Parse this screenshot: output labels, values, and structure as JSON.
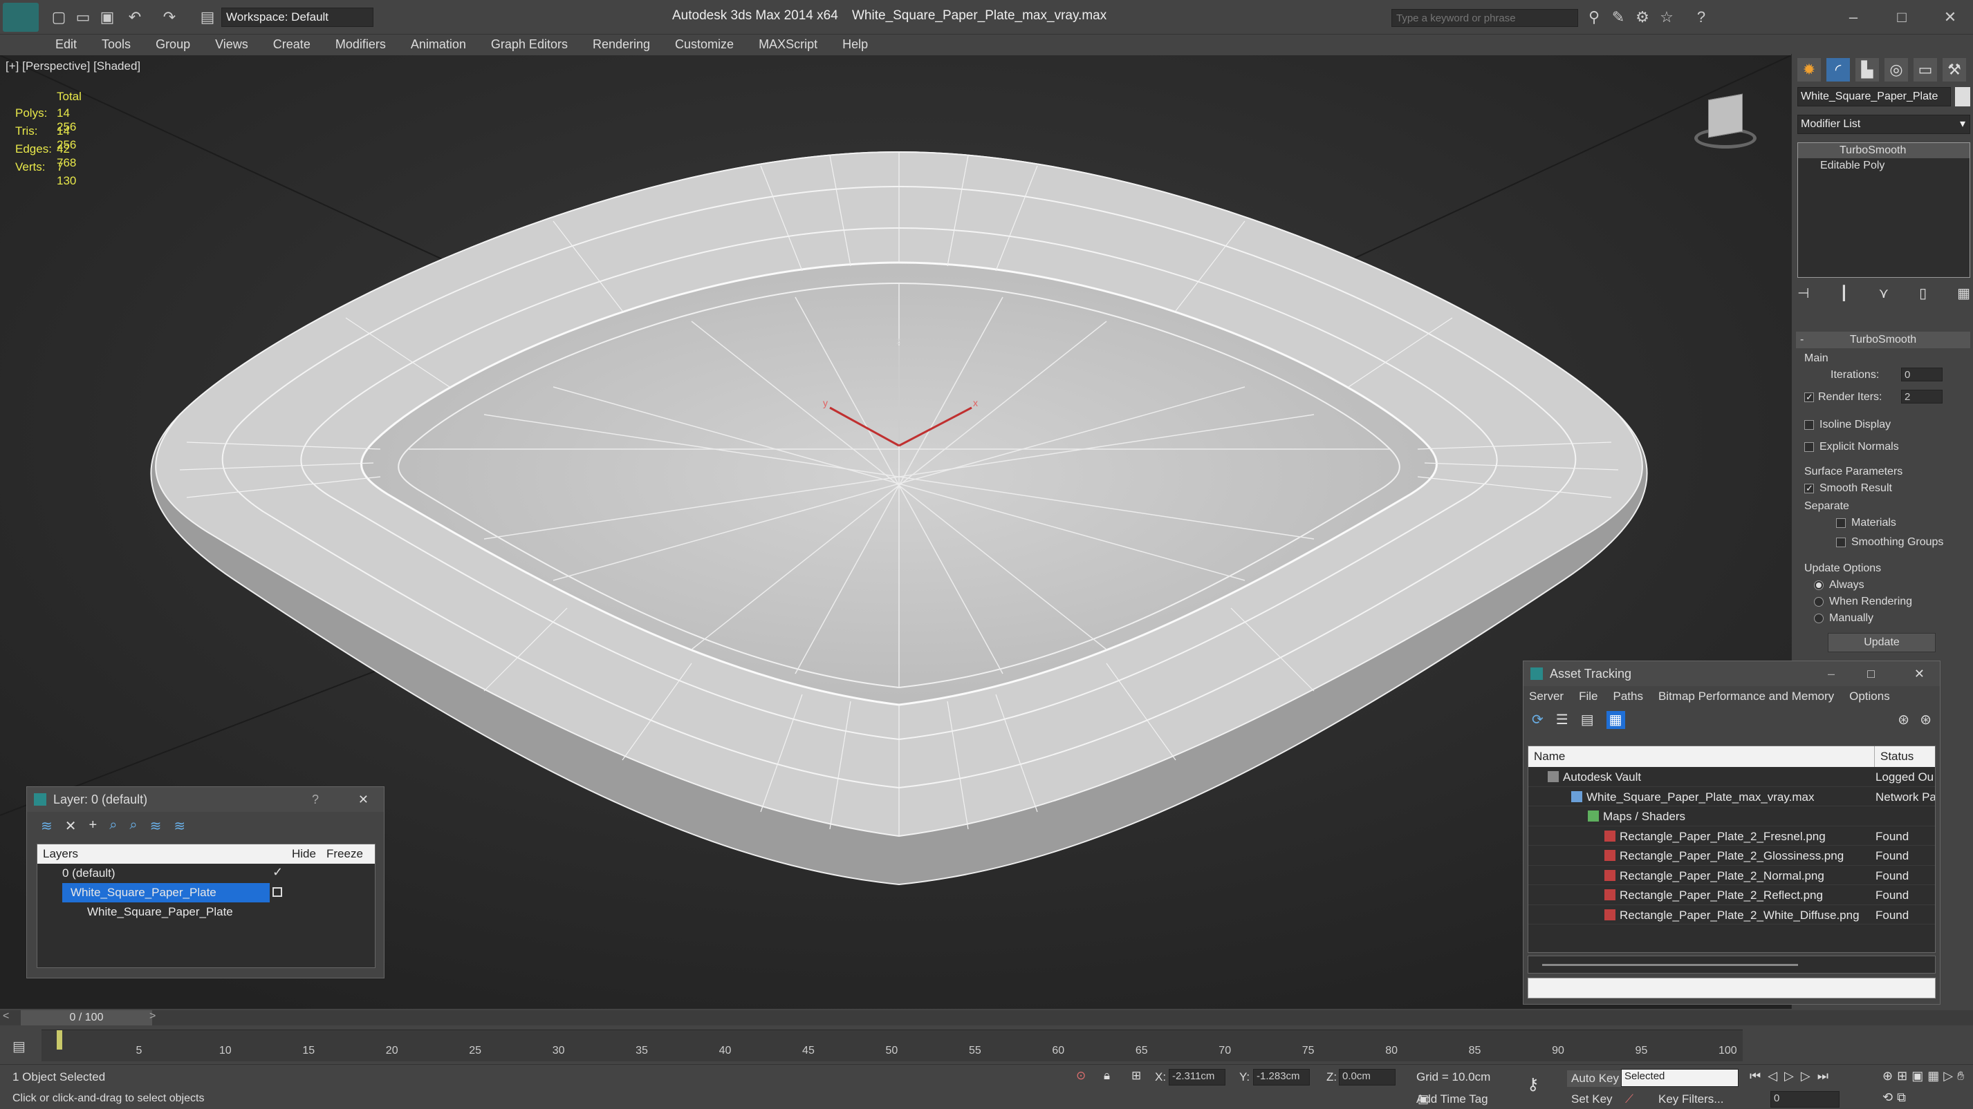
{
  "titlebar": {
    "app": "Autodesk 3ds Max  2014 x64",
    "file": "White_Square_Paper_Plate_max_vray.max",
    "workspace": "Workspace: Default",
    "search_placeholder": "Type a keyword or phrase"
  },
  "menu": [
    "Edit",
    "Tools",
    "Group",
    "Views",
    "Create",
    "Modifiers",
    "Animation",
    "Graph Editors",
    "Rendering",
    "Customize",
    "MAXScript",
    "Help"
  ],
  "viewport": {
    "label": "[+] [Perspective] [Shaded]",
    "stats": {
      "header": "Total",
      "rows": [
        {
          "k": "Polys:",
          "v": "14 256"
        },
        {
          "k": "Tris:",
          "v": "14 256"
        },
        {
          "k": "Edges:",
          "v": "42 768"
        },
        {
          "k": "Verts:",
          "v": "7 130"
        }
      ]
    }
  },
  "cmd": {
    "object_name": "White_Square_Paper_Plate",
    "modifier_list": "Modifier List",
    "stack": [
      "TurboSmooth",
      "Editable Poly"
    ],
    "rollout": "TurboSmooth",
    "main": "Main",
    "iterations_label": "Iterations:",
    "iterations": "0",
    "render_iters_label": "Render Iters:",
    "render_iters": "2",
    "isoline": "Isoline Display",
    "explicit": "Explicit Normals",
    "surface": "Surface Parameters",
    "smooth_result": "Smooth Result",
    "separate": "Separate",
    "materials": "Materials",
    "smoothing_groups": "Smoothing Groups",
    "update_options": "Update Options",
    "always": "Always",
    "when_rendering": "When Rendering",
    "manually": "Manually",
    "update_btn": "Update"
  },
  "layer": {
    "title": "Layer: 0 (default)",
    "help": "?",
    "col_layers": "Layers",
    "col_hide": "Hide",
    "col_freeze": "Freeze",
    "rows": [
      "0 (default)",
      "White_Square_Paper_Plate",
      "White_Square_Paper_Plate"
    ]
  },
  "asset": {
    "title": "Asset Tracking",
    "menu": [
      "Server",
      "File",
      "Paths",
      "Bitmap Performance and Memory",
      "Options"
    ],
    "col_name": "Name",
    "col_status": "Status",
    "rows": [
      {
        "name": "Autodesk Vault",
        "status": "Logged Ou"
      },
      {
        "name": "White_Square_Paper_Plate_max_vray.max",
        "status": "Network Pa"
      },
      {
        "name": "Maps / Shaders",
        "status": ""
      },
      {
        "name": "Rectangle_Paper_Plate_2_Fresnel.png",
        "status": "Found"
      },
      {
        "name": "Rectangle_Paper_Plate_2_Glossiness.png",
        "status": "Found"
      },
      {
        "name": "Rectangle_Paper_Plate_2_Normal.png",
        "status": "Found"
      },
      {
        "name": "Rectangle_Paper_Plate_2_Reflect.png",
        "status": "Found"
      },
      {
        "name": "Rectangle_Paper_Plate_2_White_Diffuse.png",
        "status": "Found"
      }
    ]
  },
  "timeline": {
    "frame": "0 / 100",
    "ticks": [
      "5",
      "10",
      "15",
      "20",
      "25",
      "30",
      "35",
      "40",
      "45",
      "50",
      "55",
      "60",
      "65",
      "70",
      "75",
      "80",
      "85",
      "90",
      "95",
      "100"
    ]
  },
  "status": {
    "selected": "1 Object Selected",
    "hint": "Click or click-and-drag to select objects",
    "x_label": "X:",
    "x": "-2.311cm",
    "y_label": "Y:",
    "y": "-1.283cm",
    "z_label": "Z:",
    "z": "0.0cm",
    "grid": "Grid = 10.0cm",
    "auto_key": "Auto Key",
    "selected_opt": "Selected",
    "set_key": "Set Key",
    "key_filters": "Key Filters...",
    "add_time_tag": "Add Time Tag",
    "frame_num": "0"
  }
}
